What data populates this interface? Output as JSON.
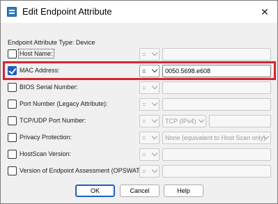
{
  "window": {
    "title": "Edit Endpoint Attribute",
    "close_glyph": "✕",
    "icon": "app-icon"
  },
  "attribute_type_label": "Endpoint Attribute Type:  Device",
  "rows": [
    {
      "label": "Host Name:",
      "checked": false,
      "operator": "=",
      "value": ""
    },
    {
      "label": "MAC Address:",
      "checked": true,
      "operator": "=",
      "value": "0050.5698.e608"
    },
    {
      "label": "BIOS Serial Number:",
      "checked": false,
      "operator": "=",
      "value": ""
    },
    {
      "label": "Port Number (Legacy Attribute):",
      "checked": false,
      "operator": "=",
      "value": ""
    },
    {
      "label": "TCP/UDP Port Number:",
      "checked": false,
      "operator": "=",
      "protocol": "TCP (IPv4)",
      "value": ""
    },
    {
      "label": "Privacy Protection:",
      "checked": false,
      "operator": "=",
      "value": "None (equivalent to Host Scan only)"
    },
    {
      "label": "HostScan Version:",
      "checked": false,
      "operator": "=",
      "value": ""
    },
    {
      "label": "Version of Endpoint Assessment (OPSWAT):",
      "checked": false,
      "operator": "=",
      "value": ""
    }
  ],
  "buttons": {
    "ok": "OK",
    "cancel": "Cancel",
    "help": "Help"
  },
  "colors": {
    "highlight": "#d4262e",
    "checkbox_checked": "#1f5fbf"
  }
}
